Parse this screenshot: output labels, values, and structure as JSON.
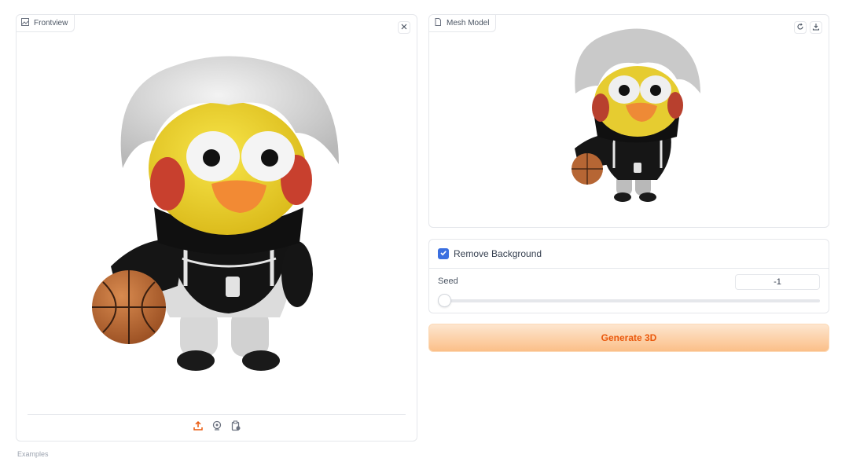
{
  "frontview": {
    "label": "Frontview",
    "icons": [
      "image-icon",
      "close-icon",
      "upload-icon",
      "webcam-icon",
      "clipboard-icon"
    ]
  },
  "mesh": {
    "label": "Mesh Model",
    "icons": [
      "file-icon",
      "reset-icon",
      "download-icon"
    ]
  },
  "options": {
    "remove_bg_label": "Remove Background",
    "remove_bg_checked": true,
    "seed_label": "Seed",
    "seed_value": "-1",
    "seed_slider_fraction": 0.0
  },
  "generate_label": "Generate 3D",
  "footer_text": "Examples",
  "colors": {
    "accent": "#ea580c",
    "checkbox": "#3b6fe0",
    "button_top": "#fde6cf",
    "button_bottom": "#fbbf88"
  }
}
